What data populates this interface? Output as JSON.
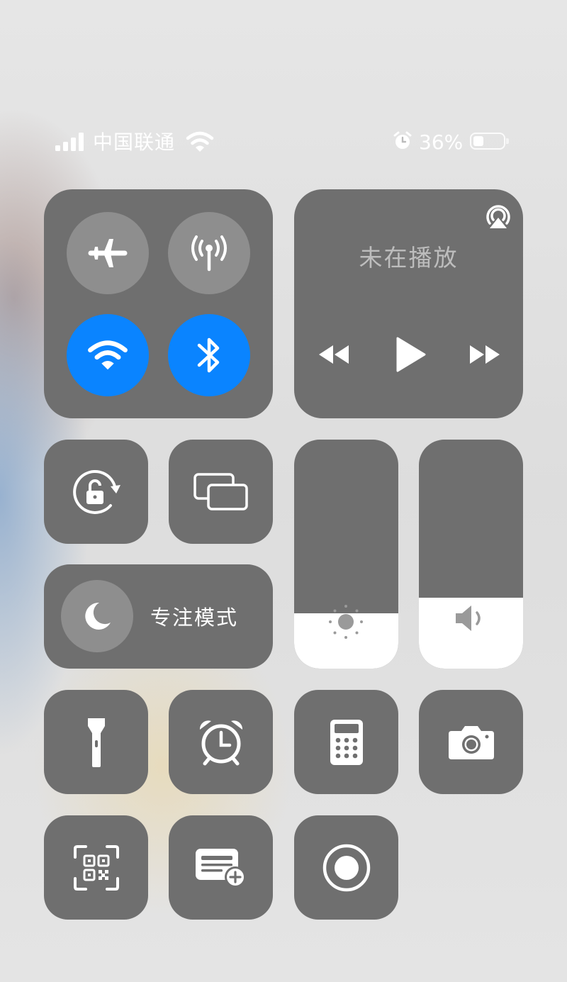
{
  "status_bar": {
    "carrier": "中国联通",
    "battery_percent": "36%",
    "battery_level": 0.36,
    "signal_bars": 4,
    "icons": [
      "cellular-signal-icon",
      "wifi-icon",
      "alarm-icon",
      "battery-icon"
    ]
  },
  "connectivity": {
    "airplane_mode": {
      "icon": "airplane-icon",
      "active": false
    },
    "cellular_data": {
      "icon": "antenna-icon",
      "active": false
    },
    "wifi": {
      "icon": "wifi-icon",
      "active": true,
      "color": "#0a84ff"
    },
    "bluetooth": {
      "icon": "bluetooth-icon",
      "active": true,
      "color": "#0a84ff"
    }
  },
  "media": {
    "title": "未在播放",
    "icons": [
      "airplay-icon",
      "rewind-icon",
      "play-icon",
      "fast-forward-icon"
    ]
  },
  "toggles": {
    "rotation_lock": {
      "icon": "rotation-lock-icon"
    },
    "screen_mirroring": {
      "icon": "screen-mirroring-icon"
    }
  },
  "focus": {
    "label": "专注模式",
    "icon": "moon-icon"
  },
  "sliders": {
    "brightness": {
      "icon": "sun-icon",
      "level": 0.24
    },
    "volume": {
      "icon": "speaker-icon",
      "level": 0.31
    }
  },
  "shortcuts": [
    {
      "icon": "flashlight-icon"
    },
    {
      "icon": "alarm-clock-icon"
    },
    {
      "icon": "calculator-icon"
    },
    {
      "icon": "camera-icon"
    },
    {
      "icon": "qr-code-scanner-icon"
    },
    {
      "icon": "wallet-add-icon"
    },
    {
      "icon": "screen-record-icon"
    }
  ],
  "colors": {
    "tile": "#6f6f6f",
    "active": "#0a84ff",
    "inactive_circle": "#8e8e8e"
  }
}
